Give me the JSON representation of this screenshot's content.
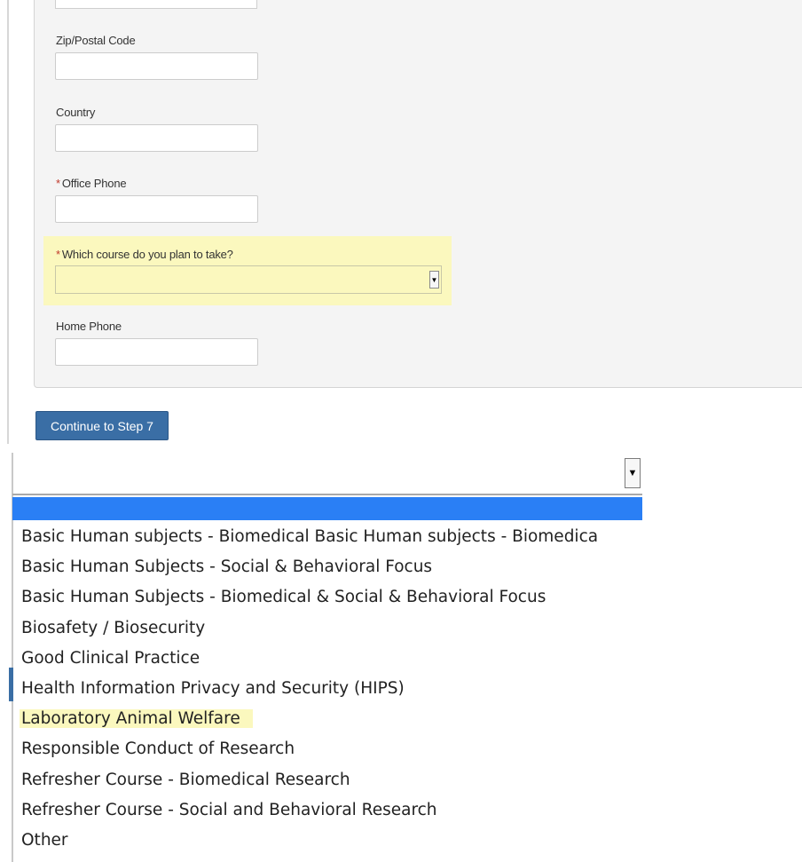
{
  "form": {
    "zip_label": "Zip/Postal Code",
    "country_label": "Country",
    "office_phone_label": "Office Phone",
    "course_label": "Which course do you plan to take?",
    "home_phone_label": "Home Phone",
    "required_marker": "*",
    "course_selected_value": "",
    "continue_label": "Continue to Step 7"
  },
  "dropdown": {
    "selected_value": "",
    "options": [
      "Basic Human subjects - Biomedical Basic Human subjects - Biomedica",
      "Basic Human Subjects - Social & Behavioral Focus",
      "Basic Human Subjects - Biomedical & Social & Behavioral Focus",
      "Biosafety / Biosecurity",
      "Good Clinical Practice",
      "Health Information Privacy and Security (HIPS)",
      "Laboratory Animal Welfare",
      "Responsible Conduct of Research",
      "Refresher Course - Biomedical Research",
      "Refresher Course - Social and Behavioral Research",
      "Other"
    ],
    "highlighted_option": "Laboratory Animal Welfare"
  },
  "colors": {
    "highlight": "#fbf8be",
    "selected_option": "#2a7ff5",
    "button": "#3a6ea5",
    "required": "#c0392b"
  },
  "icons": {
    "select_arrow": "triangle-down"
  }
}
